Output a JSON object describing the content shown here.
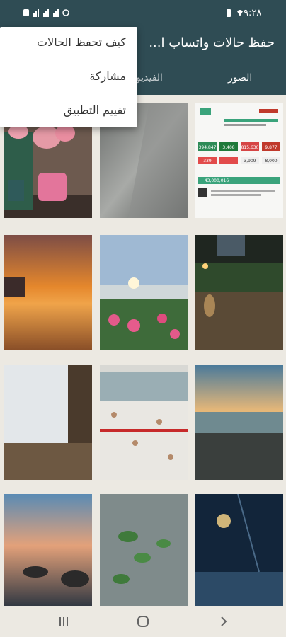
{
  "status_bar": {
    "time": "٩:٢٨"
  },
  "app_bar": {
    "title": "حفظ حالات واتساب ا..."
  },
  "tabs": [
    {
      "label": "الصور",
      "selected": true
    },
    {
      "label": "الفيديو",
      "selected": false
    }
  ],
  "overflow_menu": {
    "items": [
      {
        "label": "كيف تحفظ الحالات"
      },
      {
        "label": "مشاركة"
      },
      {
        "label": "تقييم التطبيق"
      }
    ]
  },
  "thumbnails": [
    {
      "name": "covid-stats-card",
      "numbers": [
        "9,877",
        "815,630",
        "3,408",
        "394,847",
        "8,000",
        "3,909",
        "339",
        "43,000,016"
      ]
    },
    {
      "name": "gray-light-photo"
    },
    {
      "name": "tulips-mug-photo"
    },
    {
      "name": "night-park-photo"
    },
    {
      "name": "sunset-flowers-photo"
    },
    {
      "name": "orange-sunset-sea-photo"
    },
    {
      "name": "beach-waves-photo"
    },
    {
      "name": "crowd-photo"
    },
    {
      "name": "snowy-window-books-photo"
    },
    {
      "name": "lamp-forest-photo"
    },
    {
      "name": "green-leaves-photo"
    },
    {
      "name": "rocky-sea-sunset-photo"
    }
  ],
  "colors": {
    "primary": "#2f4c54",
    "background": "#ece9e2"
  }
}
